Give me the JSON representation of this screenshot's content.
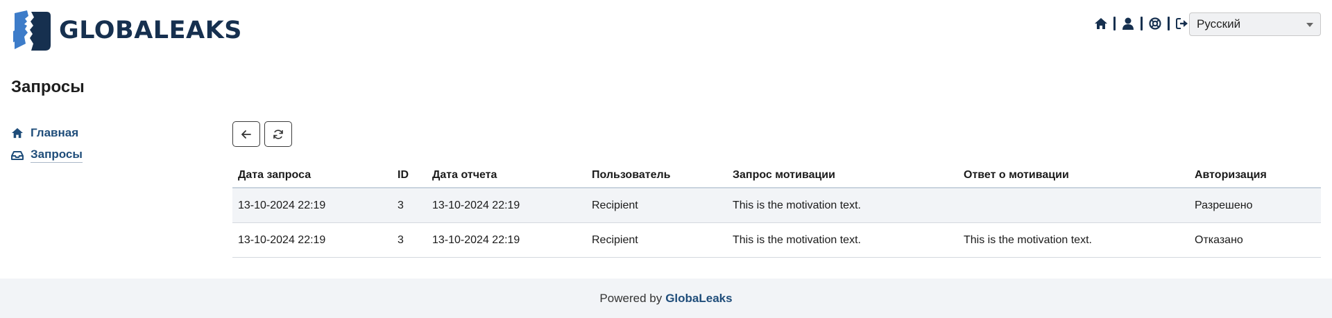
{
  "header": {
    "logo_text": "GLOBALEAKS",
    "nav_icons": [
      "home-icon",
      "user-icon",
      "support-icon",
      "logout-icon"
    ],
    "language": "Русский"
  },
  "page": {
    "title": "Запросы"
  },
  "sidebar": {
    "items": [
      {
        "label": "Главная",
        "icon": "home-icon"
      },
      {
        "label": "Запросы",
        "icon": "inbox-icon",
        "active": true
      }
    ]
  },
  "toolbar": {
    "buttons": [
      "back-arrow-icon",
      "refresh-icon"
    ]
  },
  "table": {
    "headers": [
      "Дата запроса",
      "ID",
      "Дата отчета",
      "Пользователь",
      "Запрос мотивации",
      "Ответ о мотивации",
      "Авторизация"
    ],
    "rows": [
      [
        "13-10-2024 22:19",
        "3",
        "13-10-2024 22:19",
        "Recipient",
        "This is the motivation text.",
        "",
        "Разрешено"
      ],
      [
        "13-10-2024 22:19",
        "3",
        "13-10-2024 22:19",
        "Recipient",
        "This is the motivation text.",
        "This is the motivation text.",
        "Отказано"
      ]
    ]
  },
  "footer": {
    "powered_by": "Powered by",
    "brand": "GlobaLeaks"
  },
  "colors": {
    "brand_dark": "#16304f",
    "brand_blue": "#3d7cc9",
    "link": "#1f4d7a",
    "footer_bg": "#f2f4f7"
  }
}
